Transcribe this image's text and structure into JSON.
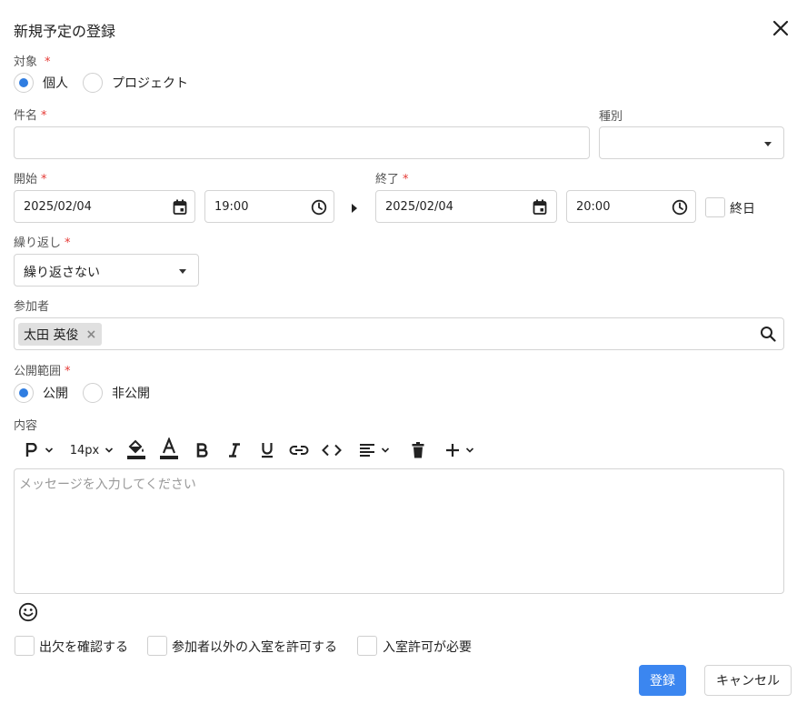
{
  "dialog": {
    "title": "新規予定の登録"
  },
  "target": {
    "label": "対象",
    "required": "*",
    "options": [
      "個人",
      "プロジェクト"
    ],
    "selected": "個人"
  },
  "subject": {
    "label": "件名",
    "required": "*",
    "value": ""
  },
  "category": {
    "label": "種別",
    "value": ""
  },
  "start": {
    "label": "開始",
    "required": "*",
    "date": "2025/02/04",
    "time": "19:00"
  },
  "end": {
    "label": "終了",
    "required": "*",
    "date": "2025/02/04",
    "time": "20:00",
    "allday_label": "終日"
  },
  "repeat": {
    "label": "繰り返し",
    "required": "*",
    "value": "繰り返さない"
  },
  "participants": {
    "label": "参加者",
    "chips": [
      "太田 英俊"
    ],
    "chip_remove": "×"
  },
  "visibility": {
    "label": "公開範囲",
    "required": "*",
    "options": [
      "公開",
      "非公開"
    ],
    "selected": "公開"
  },
  "content": {
    "label": "内容",
    "font_size": "14px",
    "placeholder": "メッセージを入力してください"
  },
  "options": {
    "attendance": "出欠を確認する",
    "allow_non_participants": "参加者以外の入室を許可する",
    "require_permission": "入室許可が必要"
  },
  "actions": {
    "submit": "登録",
    "cancel": "キャンセル"
  },
  "colors": {
    "accent": "#3b86f0",
    "radio_selected": "#2f7de1",
    "required": "#e53935"
  }
}
